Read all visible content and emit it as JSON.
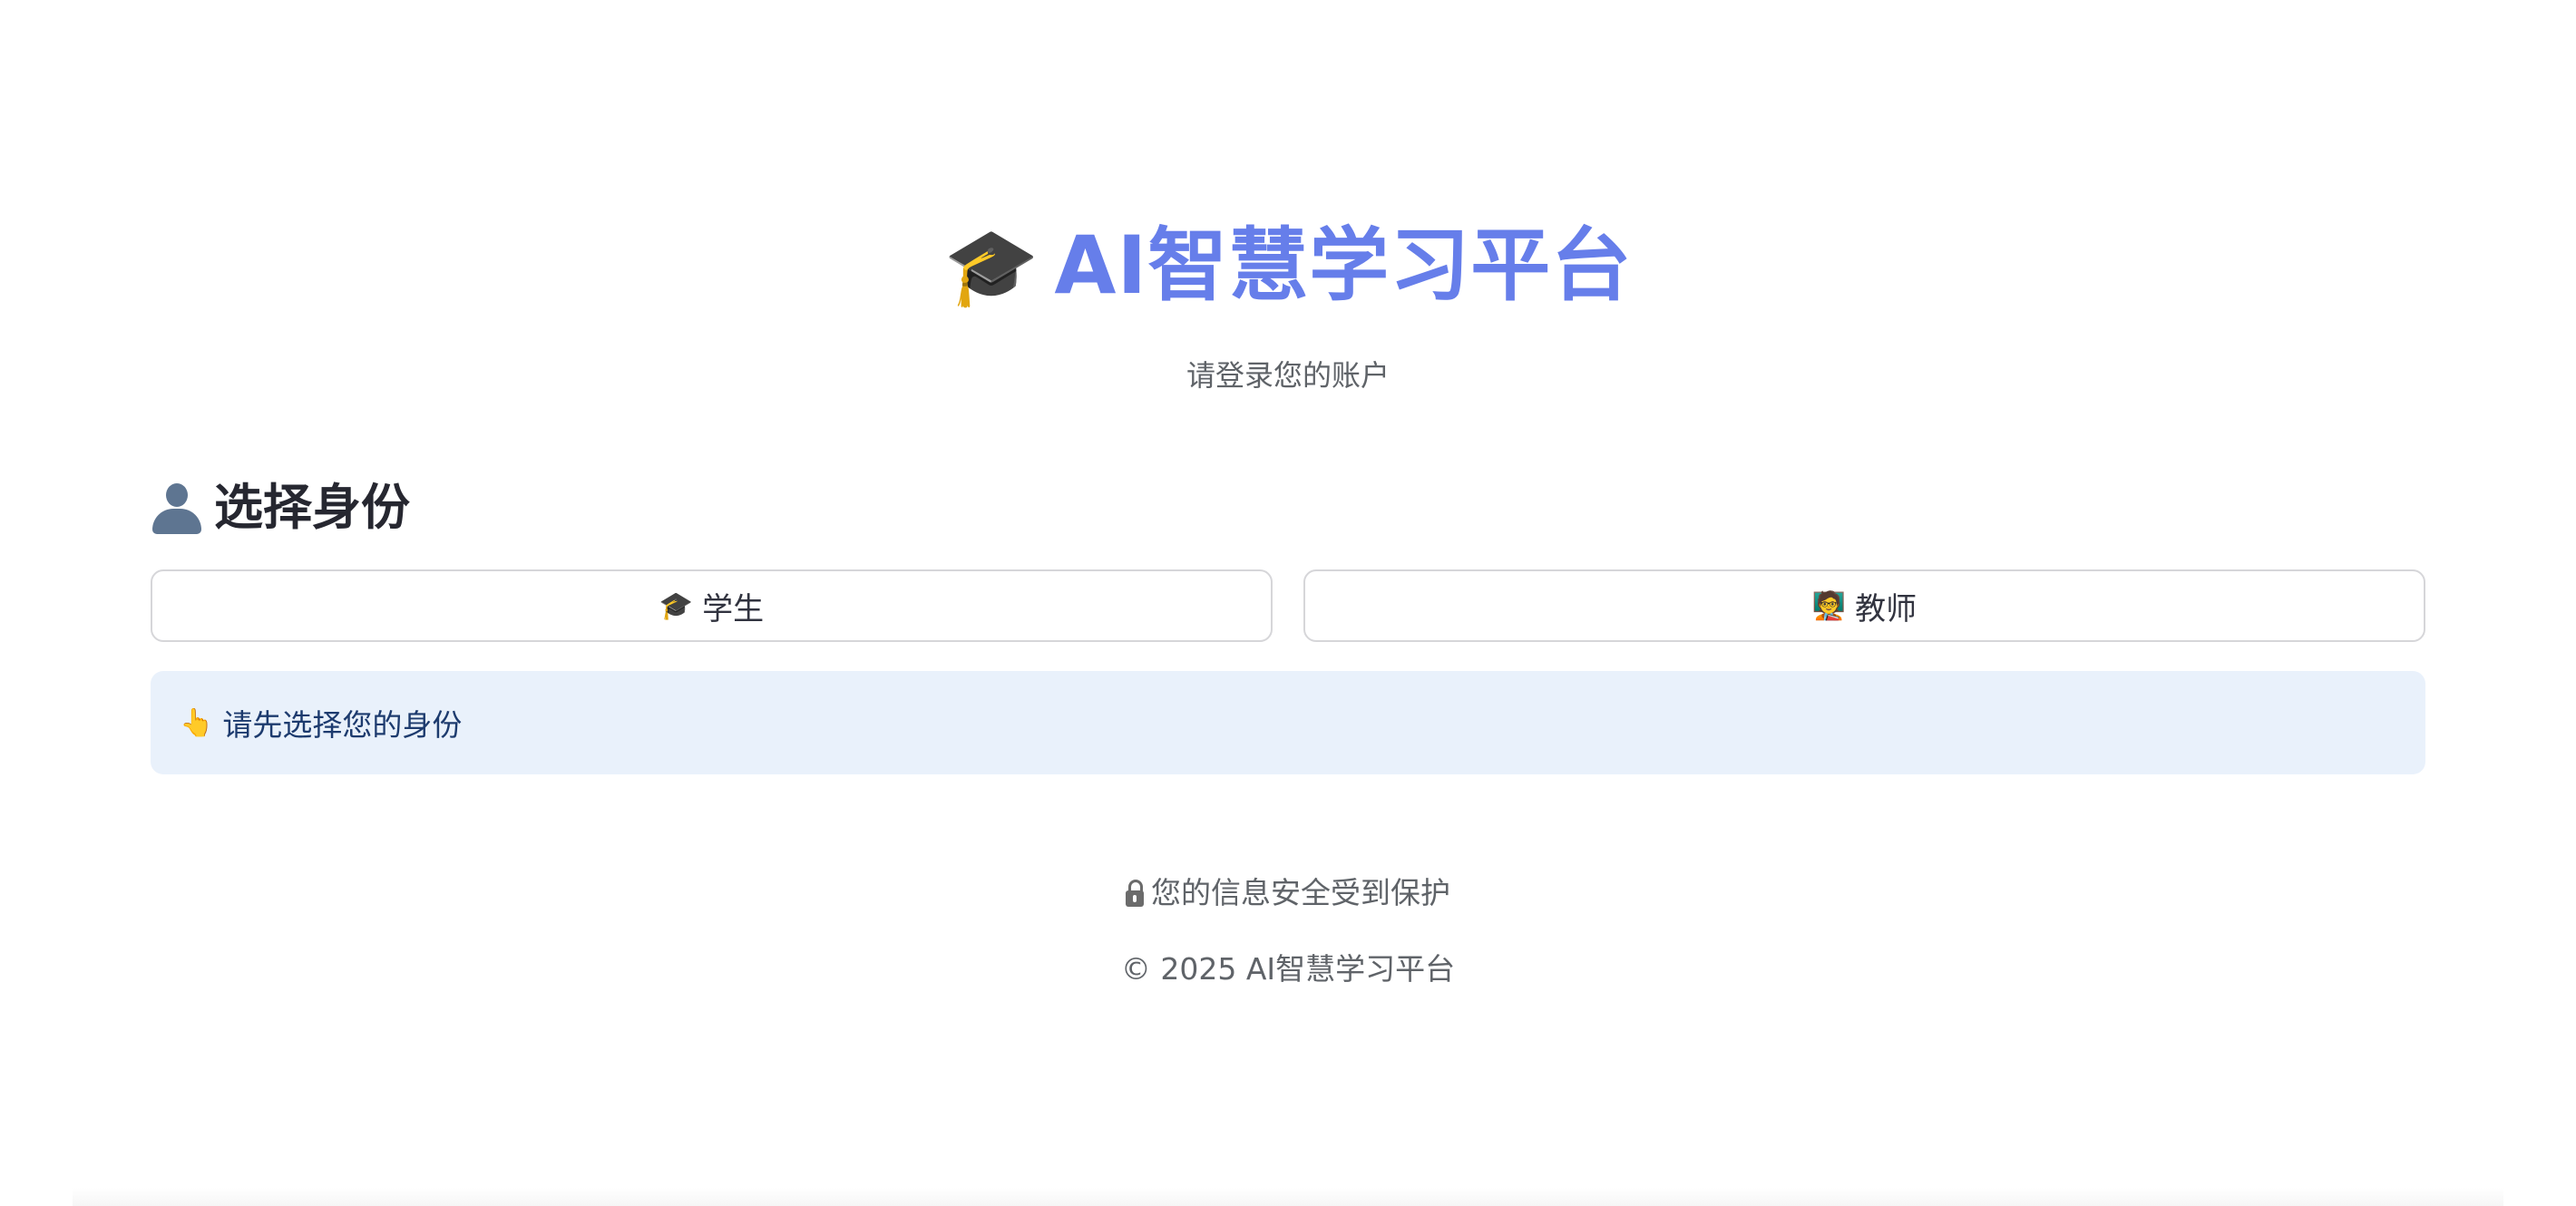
{
  "header": {
    "icon": "graduation-cap-icon",
    "title": "AI智慧学习平台",
    "subtitle": "请登录您的账户"
  },
  "role_section": {
    "icon": "user-silhouette-icon",
    "title": "选择身份",
    "buttons": [
      {
        "icon": "graduation-cap-icon",
        "label": "学生"
      },
      {
        "icon": "teacher-icon",
        "label": "教师"
      }
    ]
  },
  "info": {
    "icon": "pointing-up-icon",
    "text": "请先选择您的身份"
  },
  "footer": {
    "security_icon": "lock-icon",
    "security_text": "您的信息安全受到保护",
    "copyright": "© 2025 AI智慧学习平台"
  },
  "colors": {
    "accent": "#667eea",
    "info_bg": "#e9f1fb",
    "info_text": "#1d3b6e",
    "muted_text": "#5f6368"
  }
}
